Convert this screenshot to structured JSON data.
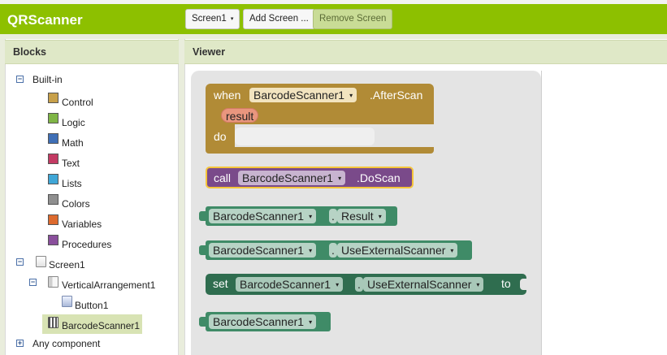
{
  "app": {
    "title": "QRScanner"
  },
  "toolbar": {
    "screen_select": "Screen1",
    "screen_caret": "▾",
    "add_screen": "Add Screen ...",
    "remove_screen": "Remove Screen"
  },
  "blocks_panel": {
    "header": "Blocks",
    "builtin_label": "Built-in",
    "builtin_items": [
      {
        "label": "Control",
        "color": "#c7a04a"
      },
      {
        "label": "Logic",
        "color": "#7fb546"
      },
      {
        "label": "Math",
        "color": "#3f6fb6"
      },
      {
        "label": "Text",
        "color": "#c33a63"
      },
      {
        "label": "Lists",
        "color": "#3fa6d6"
      },
      {
        "label": "Colors",
        "color": "#8f8f8f"
      },
      {
        "label": "Variables",
        "color": "#dd6a2e"
      },
      {
        "label": "Procedures",
        "color": "#8a4f9c"
      }
    ],
    "screen_label": "Screen1",
    "arrangement_label": "VerticalArrangement1",
    "button_label": "Button1",
    "scanner_label": "BarcodeScanner1",
    "any_component": "Any component"
  },
  "viewer": {
    "header": "Viewer",
    "event_block": {
      "when": "when",
      "component": "BarcodeScanner1",
      "event": ".AfterScan",
      "param": "result",
      "do": "do",
      "color": "#b18b36"
    },
    "call_block": {
      "call": "call",
      "component": "BarcodeScanner1",
      "method": ".DoScan",
      "color": "#7a4a8a"
    },
    "getter_result": {
      "component": "BarcodeScanner1",
      "property": "Result",
      "color": "#3f8b67"
    },
    "getter_external": {
      "component": "BarcodeScanner1",
      "property": "UseExternalScanner",
      "color": "#3f8b67"
    },
    "setter_block": {
      "set": "set",
      "component": "BarcodeScanner1",
      "property": "UseExternalScanner",
      "to": "to",
      "color": "#2f6d4f"
    },
    "component_block": {
      "component": "BarcodeScanner1",
      "color": "#3f8b67"
    },
    "dropdown": "▾",
    "dot": "."
  }
}
